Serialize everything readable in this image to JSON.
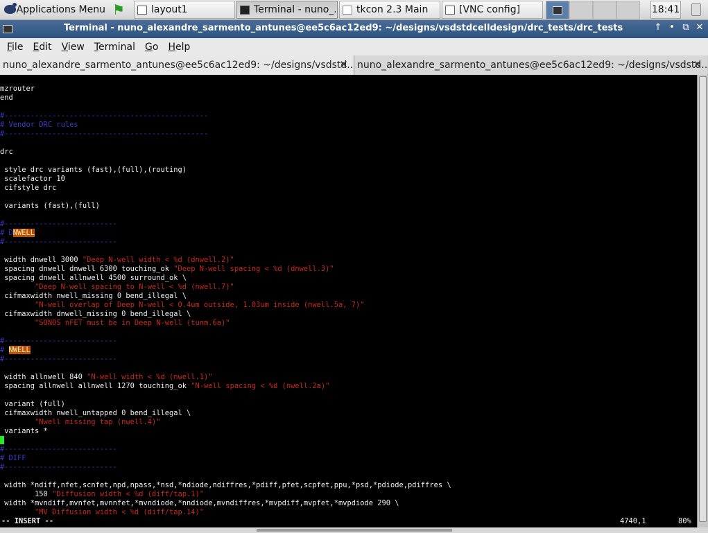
{
  "taskbar": {
    "apps_menu": "Applications Menu",
    "tasks": [
      {
        "label": "layout1",
        "icon": "window-icon",
        "active": false
      },
      {
        "label": "Terminal - nuno_...",
        "icon": "terminal-icon",
        "active": true
      },
      {
        "label": "tkcon 2.3 Main",
        "icon": "tk-window-icon",
        "active": false
      },
      {
        "label": "[VNC config]",
        "icon": "window-icon",
        "active": false
      }
    ],
    "clock": "18:41"
  },
  "window": {
    "title": "Terminal - nuno_alexandre_sarmento_antunes@ee5c6ac12ed9: ~/designs/vsdstdcelldesign/drc_tests/drc_tests",
    "controls": [
      "↑",
      "•",
      "⧉",
      "✕"
    ]
  },
  "menubar": {
    "items": [
      {
        "label": "File",
        "underline": "F",
        "rest": "ile"
      },
      {
        "label": "Edit",
        "underline": "E",
        "rest": "dit"
      },
      {
        "label": "View",
        "underline": "V",
        "rest": "iew"
      },
      {
        "label": "Terminal",
        "underline": "T",
        "rest": "erminal"
      },
      {
        "label": "Go",
        "underline": "G",
        "rest": "o"
      },
      {
        "label": "Help",
        "underline": "H",
        "rest": "elp"
      }
    ]
  },
  "tabs": [
    {
      "label": "nuno_alexandre_sarmento_antunes@ee5c6ac12ed9: ~/designs/vsdstd...",
      "close": "✕"
    },
    {
      "label": "nuno_alexandre_sarmento_antunes@ee5c6ac12ed9: ~/designs/vsdstd...",
      "close": "✕"
    }
  ],
  "terminal": {
    "lines": [
      {
        "t": "mzrouter"
      },
      {
        "t": "end"
      },
      {
        "t": ""
      },
      {
        "t": "#-----------------------------------------------",
        "c": "cmt"
      },
      {
        "t": "# Vendor DRC rules",
        "c": "cmt"
      },
      {
        "t": "#-----------------------------------------------",
        "c": "cmt"
      },
      {
        "t": ""
      },
      {
        "t": "drc"
      },
      {
        "t": ""
      },
      {
        "t": " style drc variants (fast),(full),(routing)"
      },
      {
        "t": " scalefactor 10"
      },
      {
        "t": " cifstyle drc"
      },
      {
        "t": ""
      },
      {
        "t": " variants (fast),(full)"
      },
      {
        "t": ""
      },
      {
        "t": "#--------------------------",
        "c": "cmt"
      },
      {
        "t": "# D",
        "c": "cmt",
        "hl": "NWELL"
      },
      {
        "t": "#--------------------------",
        "c": "cmt"
      },
      {
        "t": ""
      },
      {
        "t": " width dnwell 3000 ",
        "s": "\"Deep N-well width < %d (dnwell.2)\""
      },
      {
        "t": " spacing dnwell dnwell 6300 touching_ok ",
        "s": "\"Deep N-well spacing < %d (dnwell.3)\""
      },
      {
        "t": " spacing dnwell allnwell 4500 surround_ok \\"
      },
      {
        "t": "        ",
        "s": "\"Deep N-well spacing to N-well < %d (nwell.7)\""
      },
      {
        "t": " cifmaxwidth nwell_missing 0 bend_illegal \\"
      },
      {
        "t": "        ",
        "s": "\"N-well overlap of Deep N-well < 0.4um outside, 1.03um inside (nwell.5a, 7)\""
      },
      {
        "t": " cifmaxwidth dnwell_missing 0 bend_illegal \\"
      },
      {
        "t": "        ",
        "s": "\"SONOS nFET must be in Deep N-well (tunm.6a)\""
      },
      {
        "t": ""
      },
      {
        "t": "#--------------------------",
        "c": "cmt"
      },
      {
        "t": "# ",
        "c": "cmt",
        "hl": "NWELL"
      },
      {
        "t": "#--------------------------",
        "c": "cmt"
      },
      {
        "t": ""
      },
      {
        "t": " width allnwell 840 ",
        "s": "\"N-well width < %d (nwell.1)\""
      },
      {
        "t": " spacing allnwell allnwell 1270 touching_ok ",
        "s": "\"N-well spacing < %d (nwell.2a)\""
      },
      {
        "t": ""
      },
      {
        "t": " variant (full)"
      },
      {
        "t": " cifmaxwidth nwell_untapped 0 bend_illegal \\"
      },
      {
        "t": "        ",
        "s": "\"Nwell missing tap (nwell.4)\""
      },
      {
        "t": " variants *"
      },
      {
        "t": "",
        "cursor": true
      },
      {
        "t": "#--------------------------",
        "c": "cmt"
      },
      {
        "t": "# DIFF",
        "c": "cmt"
      },
      {
        "t": "#--------------------------",
        "c": "cmt"
      },
      {
        "t": ""
      },
      {
        "t": " width *ndiff,nfet,scnfet,npd,npass,*nsd,*ndiode,ndiffres,*pdiff,pfet,scpfet,ppu,*psd,*pdiode,pdiffres \\"
      },
      {
        "t": "        150 ",
        "s": "\"Diffusion width < %d (diff/tap.1)\""
      },
      {
        "t": " width *mvndiff,mvnfet,mvnnfet,*mvndiode,*nndiode,mvndiffres,*mvpdiff,mvpfet,*mvpdiode 290 \\"
      },
      {
        "t": "        ",
        "s": "\"MV Diffusion width < %d (diff/tap.14)\""
      }
    ],
    "status": {
      "mode": "-- INSERT --",
      "position": "4740,1",
      "percent": "80%"
    }
  }
}
